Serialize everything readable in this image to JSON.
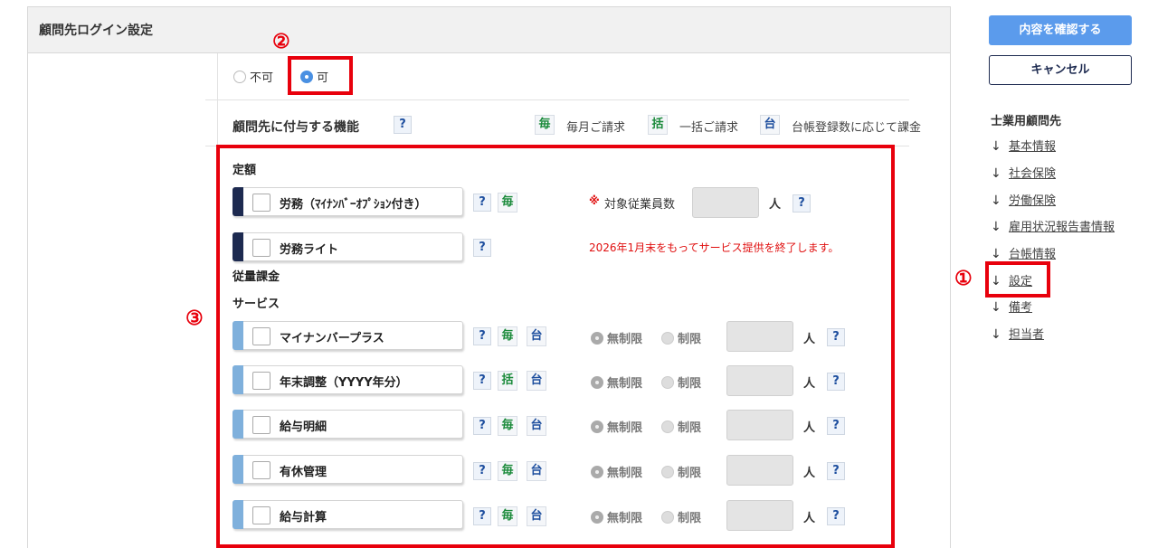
{
  "panel": {
    "title": "顧問先ログイン設定"
  },
  "login_option": {
    "no": "不可",
    "yes": "可",
    "selected": "yes"
  },
  "features_header": {
    "title": "顧問先に付与する機能",
    "help": "?",
    "legend": [
      {
        "tag": "毎",
        "text": "毎月ご請求",
        "color": "#1a8a3a"
      },
      {
        "tag": "括",
        "text": "一括ご請求",
        "color": "#1a8a3a"
      },
      {
        "tag": "台",
        "text": "台帳登録数に応じて課金",
        "color": "#1d4e9e"
      }
    ]
  },
  "categories": {
    "fixed": "定額",
    "metered": "従量課金",
    "service": "サービス"
  },
  "fixed_items": [
    {
      "label": "労務（ﾏｲﾅﾝﾊﾞｰｵﾌﾟｼｮﾝ付き）",
      "tags": [
        "?",
        "毎"
      ],
      "note_mark": "※",
      "note": "対象従業員数",
      "unit": "人",
      "help": "?"
    },
    {
      "label": "労務ライト",
      "tags": [
        "?"
      ],
      "notice": "2026年1月末をもってサービス提供を終了します。"
    }
  ],
  "service_items": [
    {
      "label": "マイナンバープラス",
      "tags": [
        "?",
        "毎",
        "台"
      ]
    },
    {
      "label": "年末調整（YYYY年分）",
      "tags": [
        "?",
        "括",
        "台"
      ]
    },
    {
      "label": "給与明細",
      "tags": [
        "?",
        "毎",
        "台"
      ]
    },
    {
      "label": "有休管理",
      "tags": [
        "?",
        "毎",
        "台"
      ]
    },
    {
      "label": "給与計算",
      "tags": [
        "?",
        "毎",
        "台"
      ]
    }
  ],
  "limit_option": {
    "unlimited": "無制限",
    "limited": "制限",
    "unit": "人",
    "help": "?"
  },
  "markers": {
    "one": "①",
    "two": "②",
    "three": "③"
  },
  "sidebar": {
    "confirm_button": "内容を確認する",
    "cancel_button": "キャンセル",
    "nav_title": "士業用顧問先",
    "arrow": "↓",
    "items": [
      "基本情報",
      "社会保険",
      "労働保険",
      "雇用状況報告書情報",
      "台帳情報",
      "設定",
      "備考",
      "担当者"
    ]
  }
}
